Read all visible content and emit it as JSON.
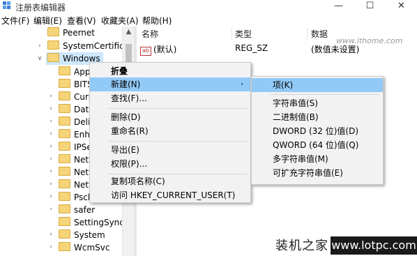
{
  "window": {
    "title": "注册表编辑器",
    "min": "—",
    "max": "☐",
    "close": "✕"
  },
  "menu": [
    "文件(F)",
    "编辑(E)",
    "查看(V)",
    "收藏夹(A)",
    "帮助(H)"
  ],
  "tree": {
    "items": [
      "Peernet",
      "SystemCertificate",
      "Windows",
      "Appx",
      "BITS",
      "Curre",
      "Data",
      "Deliv",
      "Enha",
      "IPSe",
      "Netw",
      "Netw",
      "Netw",
      "Psch",
      "safer",
      "SettingSync",
      "System",
      "WcmSvc"
    ]
  },
  "list": {
    "headers": {
      "name": "名称",
      "type": "类型",
      "data": "数据"
    },
    "rows": [
      {
        "icon": "ab",
        "name": "(默认)",
        "type": "REG_SZ",
        "data": "(数值未设置)"
      }
    ]
  },
  "context_menu": {
    "items": [
      "折叠",
      "新建(N)",
      "查找(F)...",
      "删除(D)",
      "重命名(R)",
      "导出(E)",
      "权限(P)...",
      "复制项名称(C)",
      "访问 HKEY_CURRENT_USER(T)"
    ],
    "submenu_arrow": "›"
  },
  "submenu": {
    "items": [
      "项(K)",
      "字符串值(S)",
      "二进制值(B)",
      "DWORD (32 位)值(D)",
      "QWORD (64 位)值(Q)",
      "多字符串值(M)",
      "可扩充字符串值(E)"
    ]
  },
  "watermarks": {
    "top": "www.ithome.com",
    "bottom_cn": "装机之家",
    "bottom_url": "www.lotpc.com"
  },
  "icons": {
    "tree_folder": "folder-icon",
    "expand": "chevron-right-icon",
    "collapse": "chevron-down-icon"
  },
  "colors": {
    "highlight": "#91c9f7",
    "tree_selected": "#cde8ff",
    "menu_bg": "#f2f2f2"
  }
}
